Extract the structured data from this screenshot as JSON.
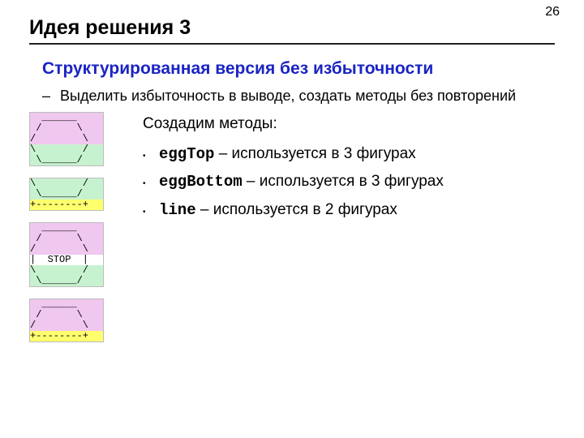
{
  "page_number": "26",
  "title": "Идея решения 3",
  "subhead": "Структурированная версия без избыточности",
  "dash_point": "Выделить избыточность в выводе, создать методы без повторений",
  "intro": "Создадим методы:",
  "methods": [
    {
      "code": "eggTop",
      "desc": " – используется в 3 фигурах"
    },
    {
      "code": "eggBottom",
      "desc": " – используется в 3 фигурах"
    },
    {
      "code": "line",
      "desc": " – используется в 2 фигурах"
    }
  ],
  "ascii": {
    "fig1_top": "  ______\n /      \\\n/        \\",
    "fig1_bot": "\\        /\n \\______/",
    "fig2_bot": "\\        /\n \\______/",
    "fig2_line": "+--------+",
    "fig3_top": "  ______\n /      \\\n/        \\",
    "fig3_mid": "|  STOP  |",
    "fig3_bot": "\\        /\n \\______/",
    "fig4_top": "  ______\n /      \\\n/        \\",
    "fig4_line": "+--------+"
  }
}
